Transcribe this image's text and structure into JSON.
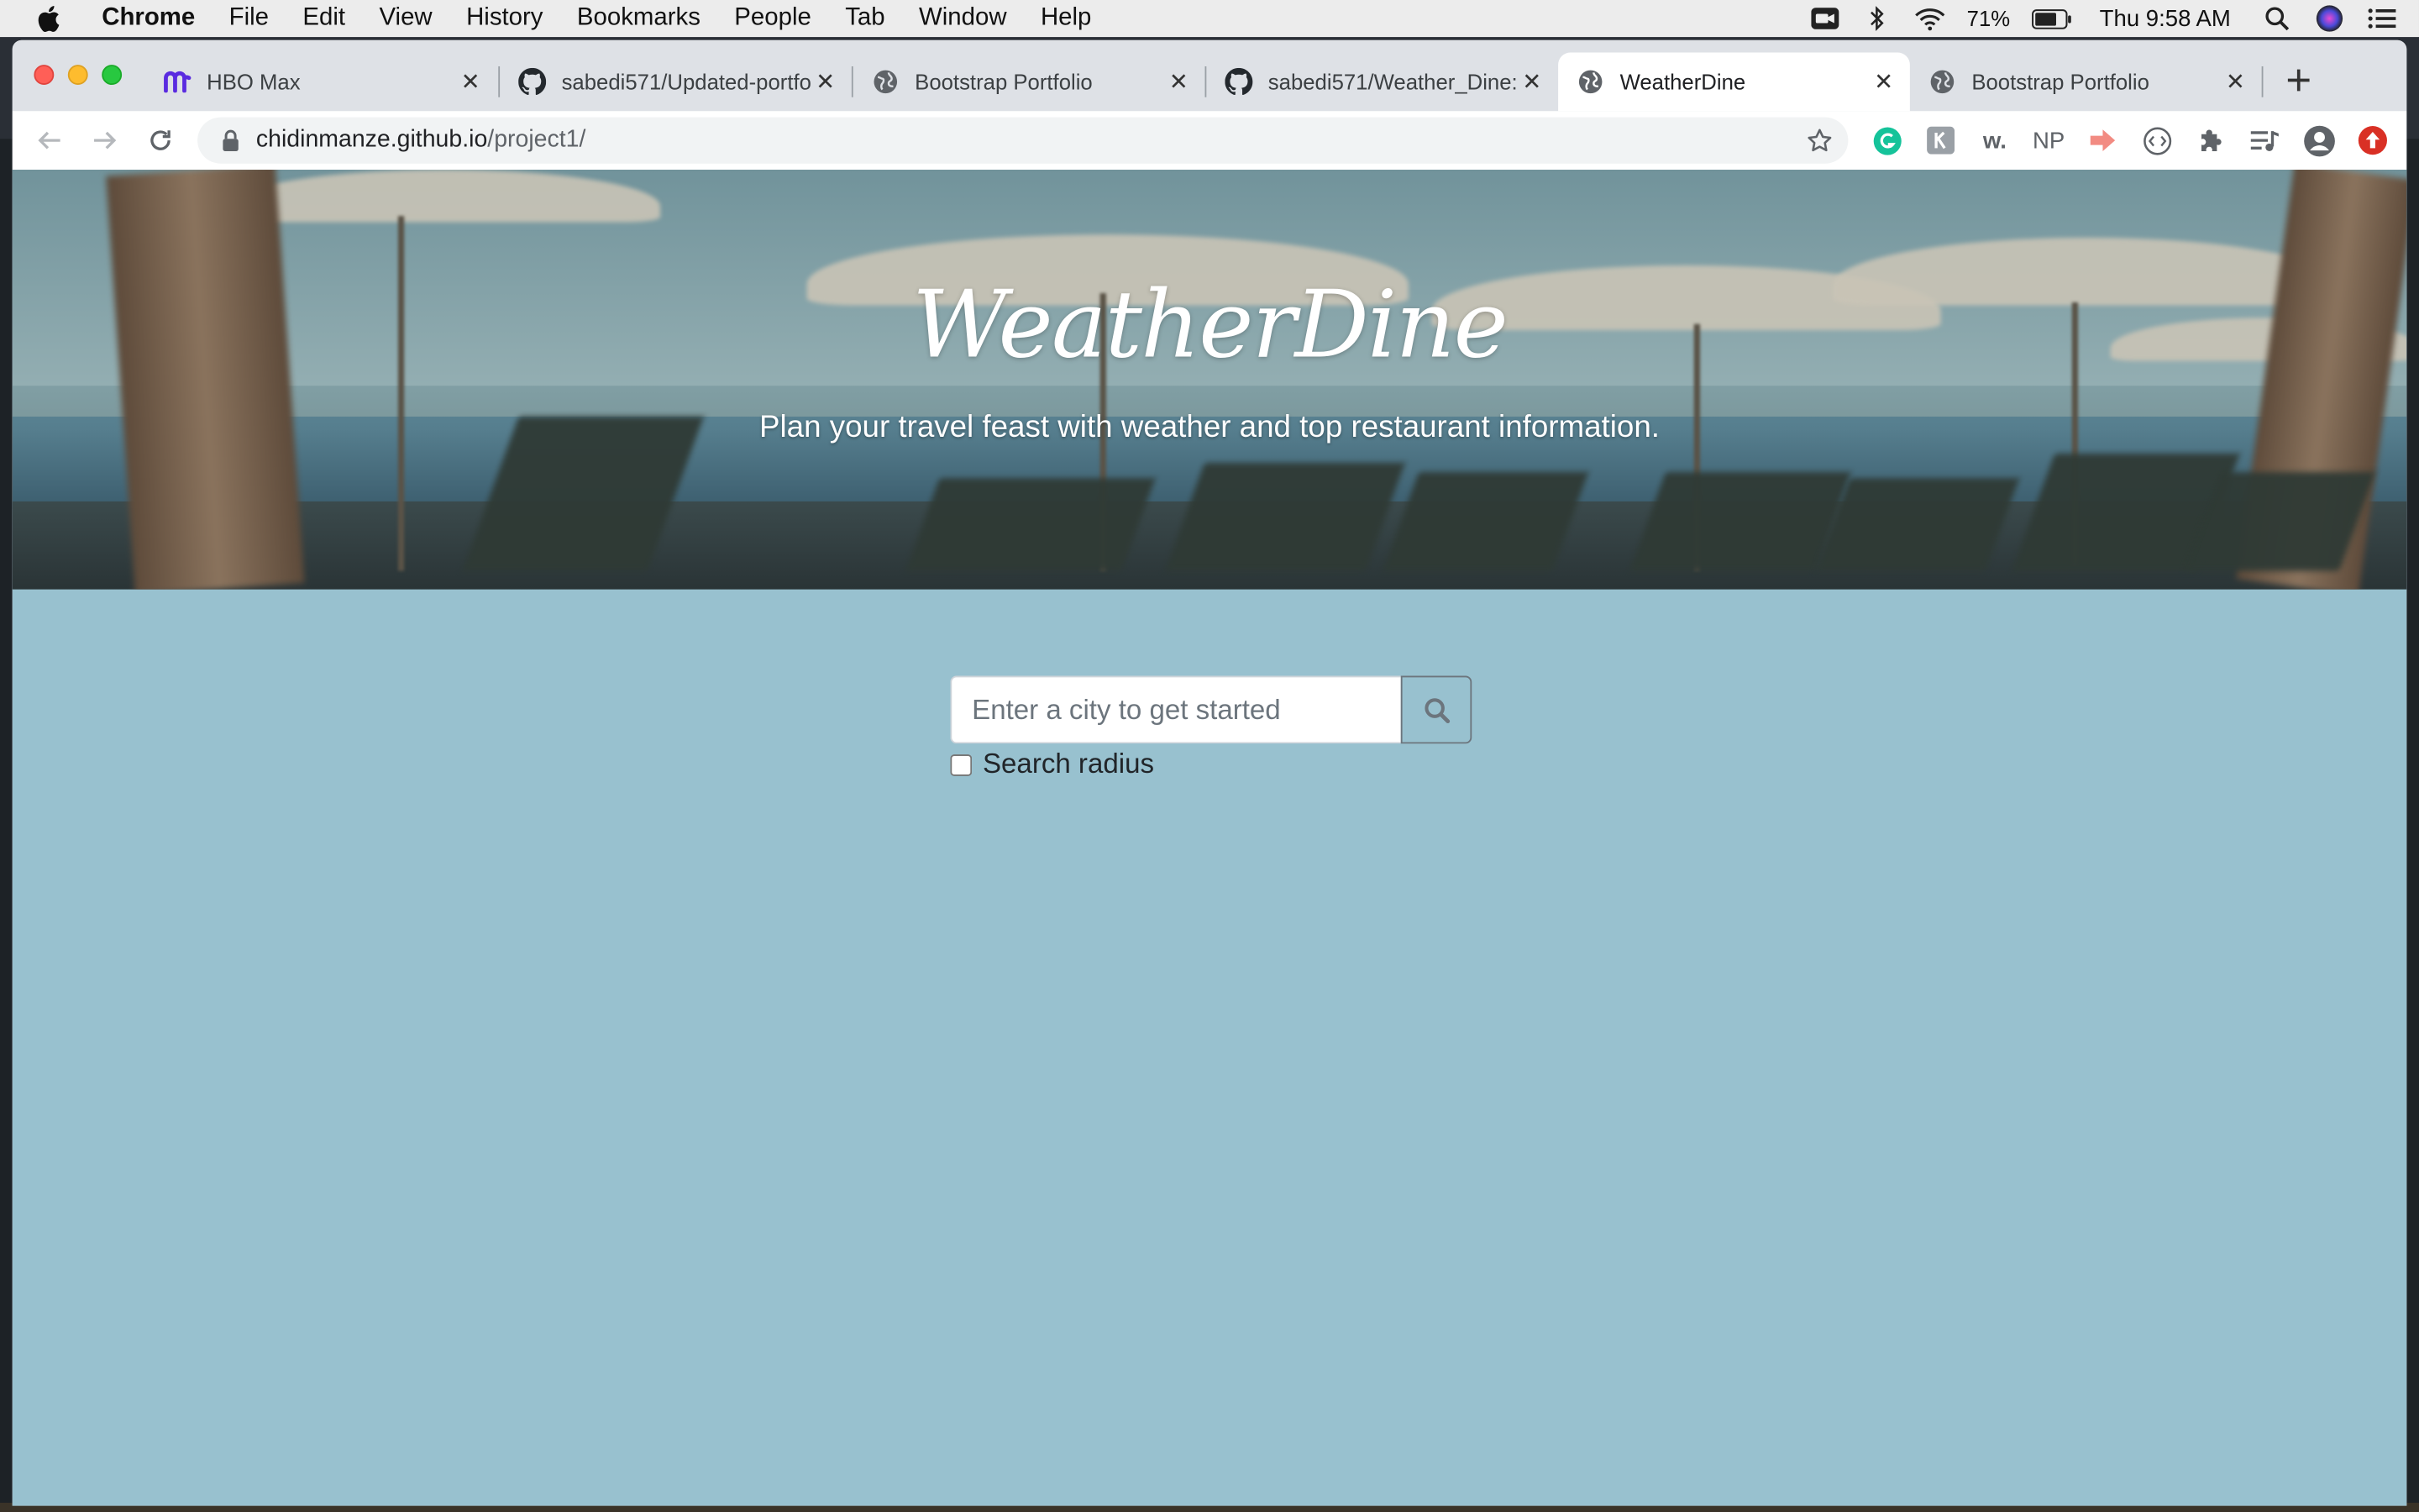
{
  "menubar": {
    "app": "Chrome",
    "items": [
      "File",
      "Edit",
      "View",
      "History",
      "Bookmarks",
      "People",
      "Tab",
      "Window",
      "Help"
    ],
    "battery": "71%",
    "clock": "Thu 9:58 AM"
  },
  "tabs": [
    {
      "title": "HBO Max",
      "icon": "hbo-max-icon",
      "active": false
    },
    {
      "title": "sabedi571/Updated-portfo",
      "icon": "github-icon",
      "active": false
    },
    {
      "title": "Bootstrap Portfolio",
      "icon": "globe-icon",
      "active": false
    },
    {
      "title": "sabedi571/Weather_Dine:",
      "icon": "github-icon",
      "active": false
    },
    {
      "title": "WeatherDine",
      "icon": "globe-icon",
      "active": true
    },
    {
      "title": "Bootstrap Portfolio",
      "icon": "globe-icon",
      "active": false
    }
  ],
  "omnibox": {
    "host": "chidinmanze.github.io",
    "path": "/project1/"
  },
  "extensions": [
    "grammarly-icon",
    "extension-k-icon",
    "extension-w-icon",
    "extension-np-icon",
    "extension-arrow-icon",
    "extension-code-icon",
    "puzzle-icon",
    "media-icon",
    "profile-icon",
    "extension-red-icon"
  ],
  "extension_labels": {
    "w": "w.",
    "np": "NP"
  },
  "page": {
    "title": "WeatherDine",
    "subtitle": "Plan your travel feast with weather and top restaurant information.",
    "search_placeholder": "Enter a city to get started",
    "search_value": "",
    "radius_label": "Search radius",
    "radius_checked": false
  },
  "colors": {
    "page_background": "#98c1cf",
    "tab_strip": "#dee1e6"
  }
}
